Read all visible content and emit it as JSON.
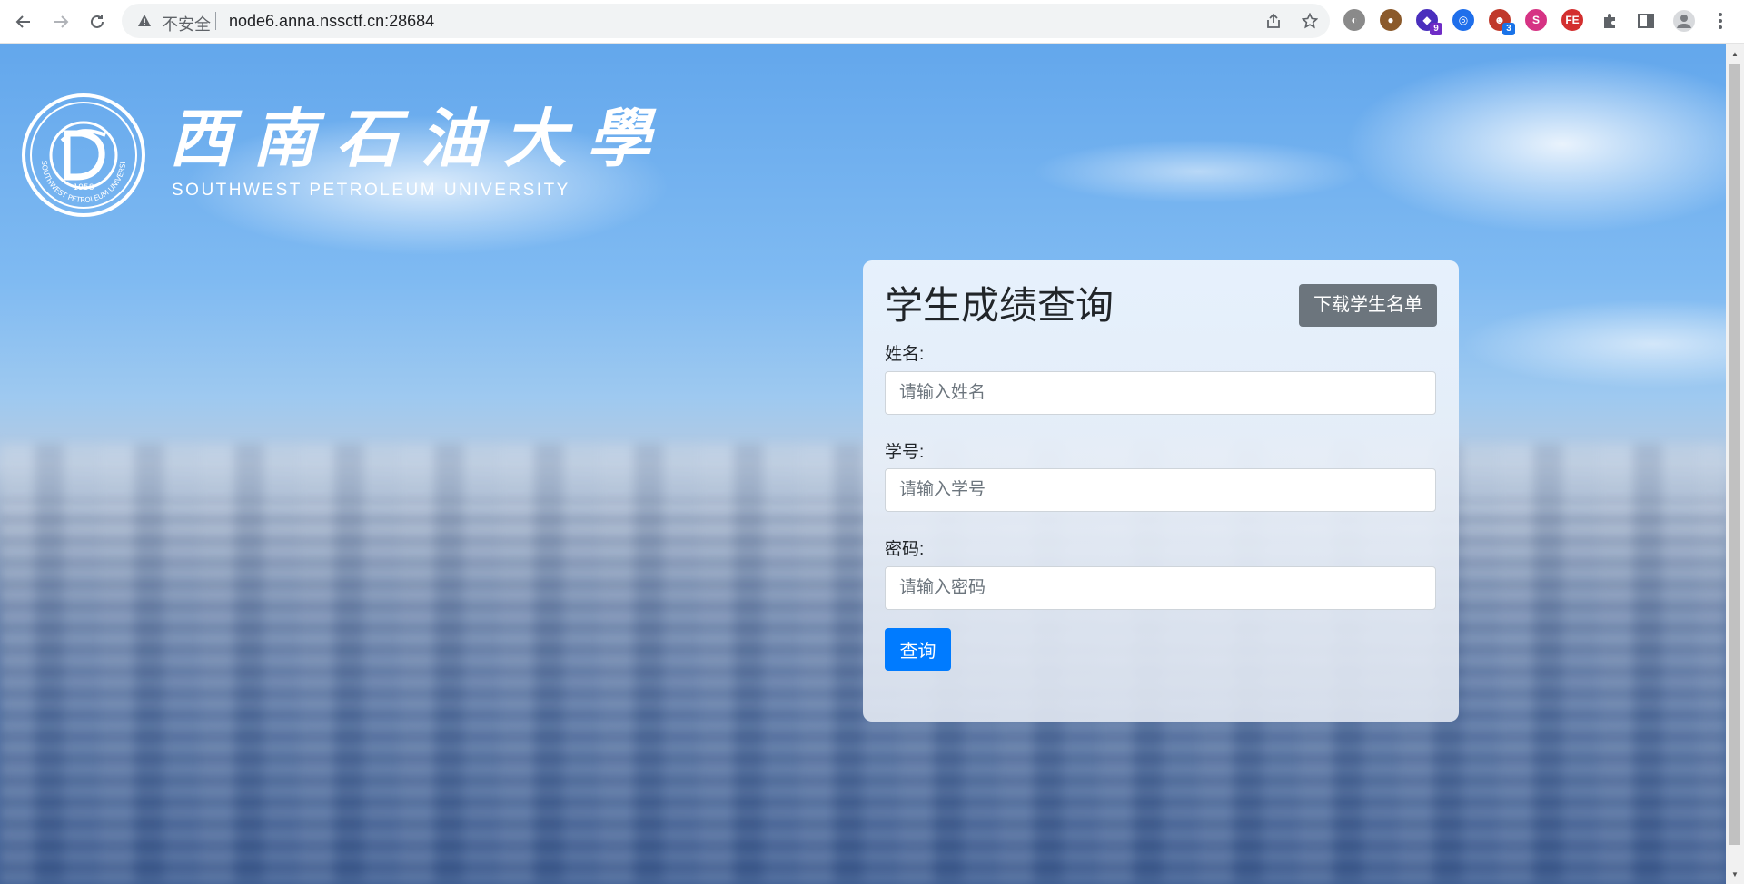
{
  "browser": {
    "security_label": "不安全",
    "url": "node6.anna.nssctf.cn:28684",
    "extensions": [
      {
        "icon": "globe-extension-icon",
        "color": "#8a8a8a",
        "badge": ""
      },
      {
        "icon": "cookie-extension-icon",
        "color": "#8b5a2b",
        "badge": ""
      },
      {
        "icon": "wappalyzer-extension-icon",
        "color": "#4a2fbd",
        "badge": "9"
      },
      {
        "icon": "circle-extension-icon",
        "color": "#1f6feb",
        "badge": ""
      },
      {
        "icon": "avatar-extension-icon",
        "color": "#c0392b",
        "badge": "3"
      },
      {
        "icon": "s-extension-icon",
        "color": "#d63384",
        "badge": ""
      },
      {
        "icon": "fe-extension-icon",
        "color": "#d32f2f",
        "badge": ""
      }
    ]
  },
  "logo": {
    "title": "西南石油大學",
    "subtitle": "SOUTHWEST PETROLEUM UNIVERSITY",
    "seal_year": "1958",
    "seal_ring_text": "SOUTHWEST PETROLEUM UNIVERSITY"
  },
  "form": {
    "title": "学生成绩查询",
    "download_button": "下载学生名单",
    "name_label": "姓名:",
    "name_placeholder": "请输入姓名",
    "id_label": "学号:",
    "id_placeholder": "请输入学号",
    "password_label": "密码:",
    "password_placeholder": "请输入密码",
    "submit_button": "查询"
  }
}
